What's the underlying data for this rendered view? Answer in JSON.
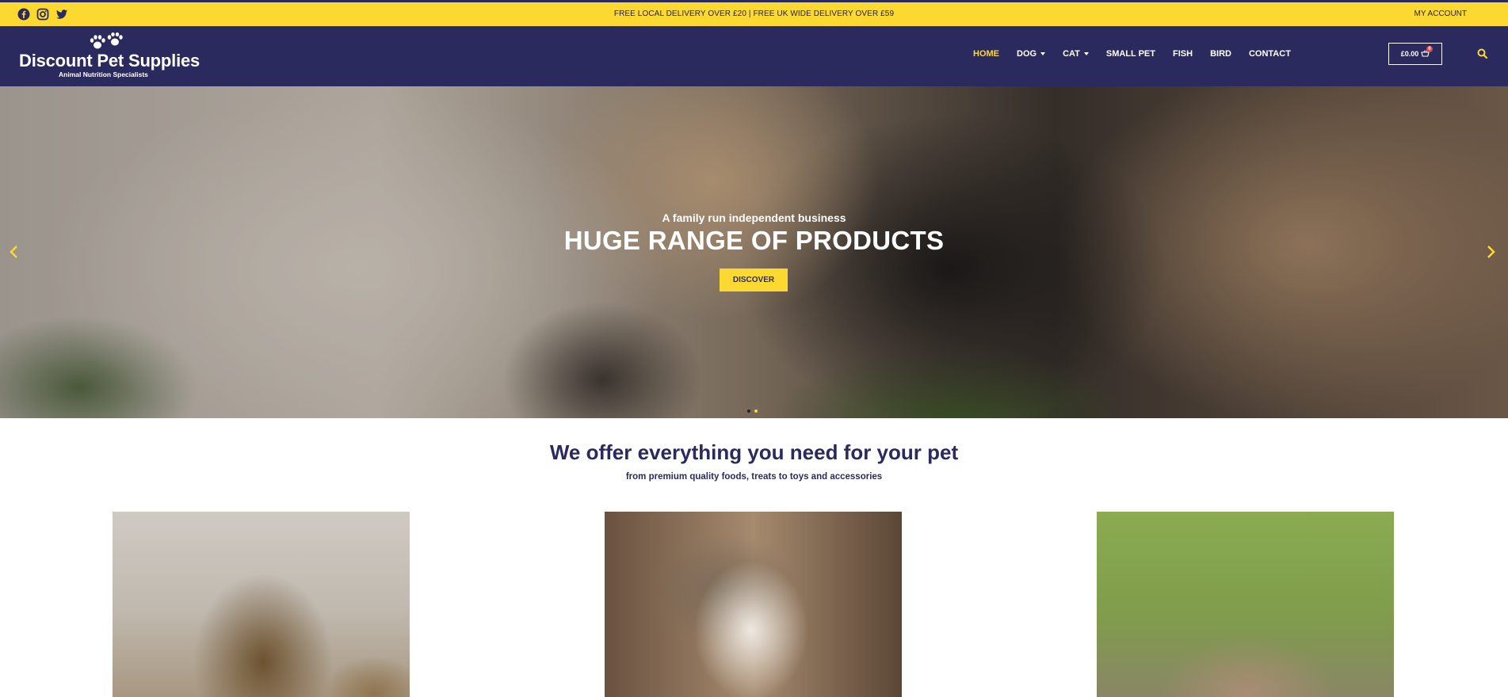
{
  "topbar": {
    "social": [
      "facebook-icon",
      "instagram-icon",
      "twitter-icon"
    ],
    "promo": "FREE LOCAL DELIVERY OVER £20 | FREE UK WIDE DELIVERY OVER £59",
    "account": "MY ACCOUNT"
  },
  "header": {
    "logo_title": "Discount Pet Supplies",
    "logo_subtitle": "Animal Nutrition Specialists",
    "nav": [
      {
        "label": "HOME"
      },
      {
        "label": "DOG"
      },
      {
        "label": "CAT"
      },
      {
        "label": "SMALL PET"
      },
      {
        "label": "FISH"
      },
      {
        "label": "BIRD"
      },
      {
        "label": "CONTACT"
      }
    ],
    "cart_total": "£0.00",
    "cart_count": "0"
  },
  "hero": {
    "tagline": "A family run independent business",
    "title": "HUGE RANGE OF PRODUCTS",
    "button": "DISCOVER",
    "slides": 2,
    "active_slide": 2
  },
  "section": {
    "title": "We offer everything you need for your pet",
    "subtitle": "from premium quality foods, treats to toys and accessories"
  },
  "colors": {
    "brand_navy": "#2b2a5e",
    "brand_yellow": "#fcd931"
  }
}
